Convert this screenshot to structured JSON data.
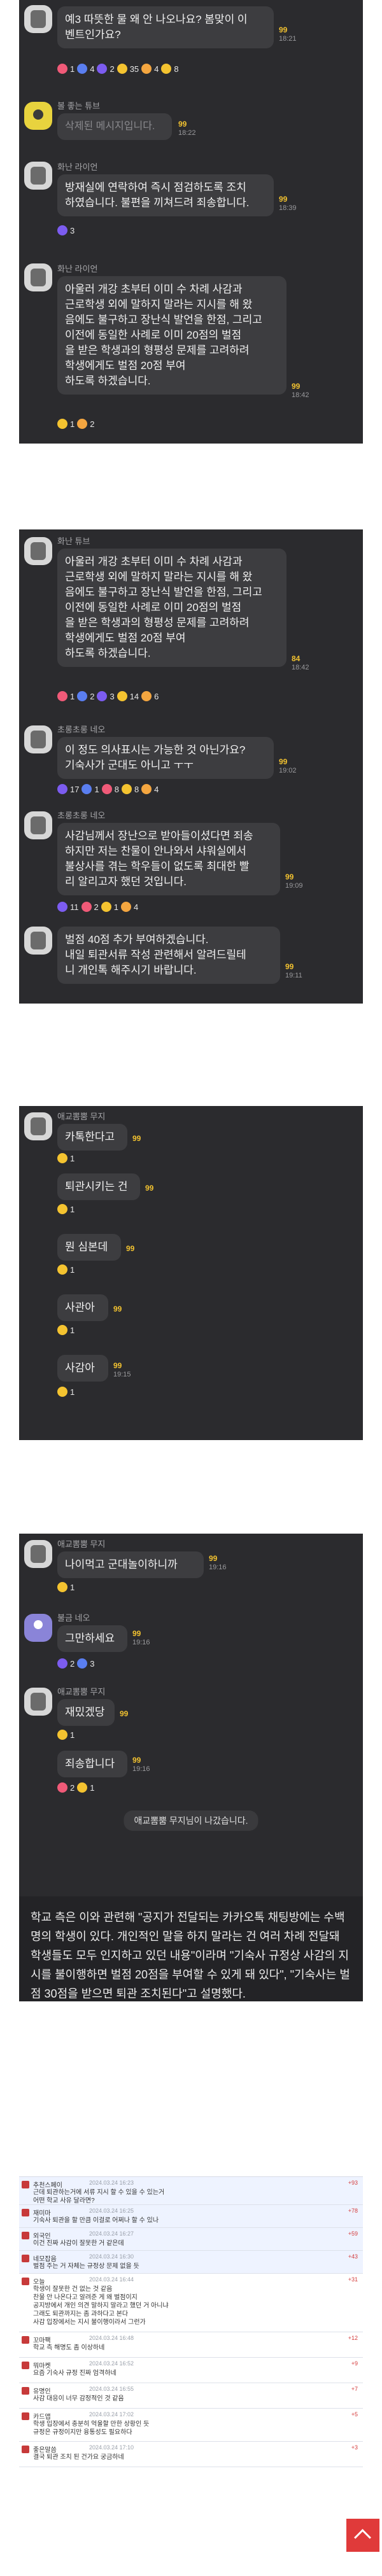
{
  "panels": [
    {
      "messages": [
        {
          "name": "",
          "text": "예3 따뜻한 물 왜 안 나오나요? 봄맞이 이\n벤트인가요?",
          "count": "99",
          "time": "18:21",
          "reactions": [
            "1",
            "4",
            "2",
            "35",
            "4",
            "8"
          ]
        },
        {
          "name": "볼 좋는 튜브",
          "text": "삭제된 메시지입니다.",
          "count": "99",
          "time": "18:22"
        },
        {
          "name": "화난 라이언",
          "text": "방재실에 연락하여 즉시 점검하도록 조치\n하였습니다. 불편을 끼쳐드려 죄송합니다.",
          "count": "99",
          "time": "18:39",
          "reactions": [
            "3"
          ]
        },
        {
          "name": "화난 라이언",
          "text": "아울러 개강 초부터 이미 수 차례 사감과\n근로학생 외에 말하지 말라는 지시를 해 왔\n음에도 불구하고 장난식 발언을 한점, 그리고\n 이전에 동일한 사례로 이미 20점의 벌점\n을 받은 학생과의 형평성 문제를 고려하려\n학생에게도 벌점 20점 부여\n하도록 하겠습니다.",
          "count": "99",
          "time": "18:42",
          "reactions": [
            "1",
            "2"
          ]
        }
      ]
    },
    {
      "messages": [
        {
          "name": "화난 튜브",
          "text": "아울러 개강 초부터 이미 수 차례 사감과\n근로학생 외에 말하지 말라는 지시를 해 왔\n음에도 불구하고 장난식 발언을 한점, 그리고\n 이전에 동일한 사례로 이미 20점의 벌점\n을 받은 학생과의 형평성 문제를 고려하려\n학생에게도 벌점 20점 부여\n하도록 하겠습니다.",
          "count": "84",
          "time": "18:42",
          "reactions": [
            "1",
            "2",
            "3",
            "14",
            "6"
          ]
        },
        {
          "name": "초롱초롱 네오",
          "text": "이 정도 의사표시는 가능한 것 아닌가요?\n기숙사가 군대도 아니고 ㅜㅜ",
          "count": "99",
          "time": "19:02",
          "reactions": [
            "17",
            "1",
            "8",
            "8",
            "4"
          ]
        },
        {
          "name": "초롱초롱 네오",
          "text": "사감님께서 장난으로 받아들이셨다면 죄송\n하지만 저는 찬물이 안나와서 샤워실에서\n불상사를 겪는 학우들이 없도록 최대한 빨\n리 알리고자 했던 것입니다.",
          "count": "99",
          "time": "19:09",
          "reactions": [
            "11",
            "2",
            "1",
            "4"
          ]
        },
        {
          "name": "",
          "text": "벌점 40점 추가 부여하겠습니다.\n내일 퇴관서류 작성 관련해서 알려드릴테\n니 개인톡 해주시기 바랍니다.",
          "count": "99",
          "time": "19:11"
        }
      ]
    },
    {
      "messages": [
        {
          "name": "애교뽐뿜 무지",
          "text": "카톡한다고",
          "count": "99",
          "reactions": [
            "1"
          ]
        },
        {
          "name": "",
          "text": "퇴관시키는 건",
          "count": "99",
          "reactions": [
            "1"
          ]
        },
        {
          "name": "",
          "text": "뭔 심본데",
          "count": "99",
          "reactions": [
            "1"
          ]
        },
        {
          "name": "",
          "text": "사관아",
          "count": "99",
          "reactions": [
            "1"
          ]
        },
        {
          "name": "",
          "text": "사감아",
          "count": "99",
          "time": "19:15",
          "reactions": [
            "1"
          ]
        }
      ]
    },
    {
      "messages": [
        {
          "name": "애교뽐뿜 무지",
          "text": "나이먹고 군대놀이하니까",
          "count": "99",
          "time": "19:16",
          "reactions": [
            "1"
          ]
        },
        {
          "name": "불금 네오",
          "text": "그만하세요",
          "count": "99",
          "time": "19:16",
          "reactions": [
            "2",
            "3"
          ]
        },
        {
          "name": "애교뽐뿜 무지",
          "text": "재밌겠당",
          "count": "99",
          "reactions": [
            "1"
          ]
        },
        {
          "name": "",
          "text": "죄송합니다",
          "count": "99",
          "time": "19:16",
          "reactions": [
            "2",
            "1"
          ]
        }
      ],
      "system": "애교뽐뿜 무지님이 나갔습니다."
    }
  ],
  "caption": "학교 측은 이와 관련해 \"공지가 전달되는 카카오톡 채팅방에는 수백 명의 학생이 있다. 개인적인 말을 하지 말라는 건 여러 차례 전달돼 학생들도 모두 인지하고 있던 내용\"이라며 \"기숙사 규정상 사감의 지시를 불이행하면 벌점 20점을 부여할 수 있게 돼 있다\", \"기숙사는 벌점 30점을 받으면 퇴관 조치된다\"고 설명했다.",
  "comments": [
    {
      "nick": "추천스페이",
      "date": "2024.03.24 16:23",
      "score": "+93",
      "text": "근데 퇴관하는거에 서류 지시 할 수 있을 수 있는거\n어떤 학교 사유 달라면?"
    },
    {
      "nick": "재미마",
      "date": "2024.03.24 16:25",
      "score": "+78",
      "text": "기숙사 퇴관을 할 만큼 이걸로 어쩌나 할 수 있나"
    },
    {
      "nick": "외국인",
      "date": "2024.03.24 16:27",
      "score": "+59",
      "text": "이건 진짜 사감이 잘못한 거 같은데"
    },
    {
      "nick": "네모잡음",
      "date": "2024.03.24 16:30",
      "score": "+43",
      "text": "벌점 주는 거 자체는 규정상 문제 없을 듯"
    },
    {
      "nick": "오늘",
      "date": "2024.03.24 16:44",
      "score": "+31",
      "text": "학생이 잘못한 건 없는 것 같음\n찬물 안 나온다고 알려준 게 왜 벌점이지\n공지방에서 개인 의견 말하지 말라고 했던 거 아니냐\n그래도 퇴관까지는 좀 과하다고 본다\n사감 입장에서는 지시 불이행이라서 그런가"
    },
    {
      "nick": "꼬마팩",
      "date": "2024.03.24 16:48",
      "score": "+12",
      "text": "학교 측 해명도 좀 이상하네"
    },
    {
      "nick": "뭐마켓",
      "date": "2024.03.24 16:52",
      "score": "+9",
      "text": "요즘 기숙사 규정 진짜 엄격하네"
    },
    {
      "nick": "유명인",
      "date": "2024.03.24 16:55",
      "score": "+7",
      "text": "사감 대응이 너무 감정적인 것 같음"
    },
    {
      "nick": "카드앱",
      "date": "2024.03.24 17:02",
      "score": "+5",
      "text": "학생 입장에서 충분히 억울할 만한 상황인 듯\n규정은 규정이지만 융통성도 필요하다"
    },
    {
      "nick": "좋은말씀",
      "date": "2024.03.24 17:10",
      "score": "+3",
      "text": "결국 퇴관 조치 된 건가요 궁금하네"
    }
  ]
}
